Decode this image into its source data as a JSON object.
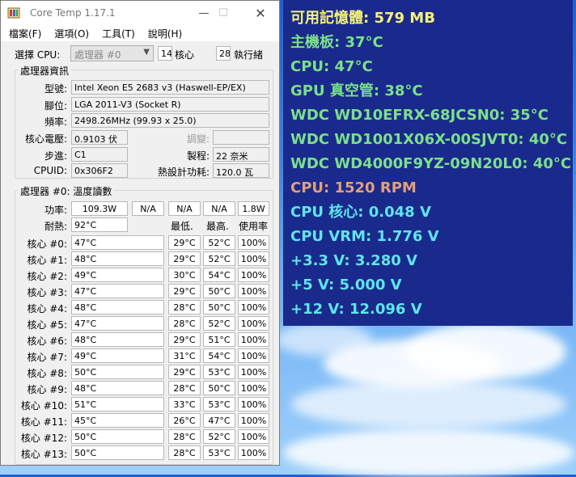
{
  "window": {
    "title": "Core Temp 1.17.1",
    "menus": [
      "檔案(F)",
      "選項(O)",
      "工具(T)",
      "說明(H)"
    ]
  },
  "select_cpu": {
    "label": "選擇 CPU:",
    "value": "處理器 #0",
    "cores_value": "14",
    "cores_label": "核心",
    "threads_value": "28",
    "threads_label": "執行緒"
  },
  "processor_info": {
    "title": "處理器資訊",
    "model_label": "型號:",
    "model_value": "Intel Xeon E5 2683 v3 (Haswell-EP/EX)",
    "platform_label": "腳位:",
    "platform_value": "LGA 2011-V3 (Socket R)",
    "freq_label": "頻率:",
    "freq_value": "2498.26MHz (99.93 x 25.0)",
    "vid_label": "核心電壓:",
    "vid_value": "0.9103 伏",
    "mod_label": "調變:",
    "mod_value": "",
    "stepping_label": "步進:",
    "stepping_value": "C1",
    "lith_label": "製程:",
    "lith_value": "22 奈米",
    "cpuid_label": "CPUID:",
    "cpuid_value": "0x306F2",
    "tdp_label": "熱設計功耗:",
    "tdp_value": "120.0 瓦"
  },
  "temps": {
    "title": "處理器 #0: 溫度讀數",
    "power_label": "功率:",
    "power_values": [
      "109.3W",
      "N/A",
      "N/A",
      "N/A",
      "1.8W"
    ],
    "tjmax_label": "耐熱:",
    "tjmax_value": "92°C",
    "col_min": "最低.",
    "col_max": "最高.",
    "col_load": "使用率",
    "cores": [
      {
        "label": "核心 #0:",
        "temp": "47°C",
        "min": "29°C",
        "max": "52°C",
        "load": "100%"
      },
      {
        "label": "核心 #1:",
        "temp": "48°C",
        "min": "29°C",
        "max": "52°C",
        "load": "100%"
      },
      {
        "label": "核心 #2:",
        "temp": "49°C",
        "min": "30°C",
        "max": "54°C",
        "load": "100%"
      },
      {
        "label": "核心 #3:",
        "temp": "47°C",
        "min": "29°C",
        "max": "50°C",
        "load": "100%"
      },
      {
        "label": "核心 #4:",
        "temp": "48°C",
        "min": "28°C",
        "max": "50°C",
        "load": "100%"
      },
      {
        "label": "核心 #5:",
        "temp": "47°C",
        "min": "28°C",
        "max": "52°C",
        "load": "100%"
      },
      {
        "label": "核心 #6:",
        "temp": "48°C",
        "min": "29°C",
        "max": "51°C",
        "load": "100%"
      },
      {
        "label": "核心 #7:",
        "temp": "49°C",
        "min": "31°C",
        "max": "54°C",
        "load": "100%"
      },
      {
        "label": "核心 #8:",
        "temp": "50°C",
        "min": "29°C",
        "max": "53°C",
        "load": "100%"
      },
      {
        "label": "核心 #9:",
        "temp": "48°C",
        "min": "28°C",
        "max": "50°C",
        "load": "100%"
      },
      {
        "label": "核心 #10:",
        "temp": "51°C",
        "min": "33°C",
        "max": "53°C",
        "load": "100%"
      },
      {
        "label": "核心 #11:",
        "temp": "45°C",
        "min": "26°C",
        "max": "47°C",
        "load": "100%"
      },
      {
        "label": "核心 #12:",
        "temp": "50°C",
        "min": "28°C",
        "max": "52°C",
        "load": "100%"
      },
      {
        "label": "核心 #13:",
        "temp": "50°C",
        "min": "28°C",
        "max": "53°C",
        "load": "100%"
      }
    ]
  },
  "overlay": {
    "lines": [
      {
        "text": "可用記憶體: 579 MB",
        "color": "#f6f27a"
      },
      {
        "text": "主機板: 37°C",
        "color": "#7be08a"
      },
      {
        "text": "CPU: 47°C",
        "color": "#7be08a"
      },
      {
        "text": "GPU 真空管: 38°C",
        "color": "#7be08a"
      },
      {
        "text": "WDC WD10EFRX-68JCSN0: 35°C",
        "color": "#7be08a"
      },
      {
        "text": "WDC WD1001X06X-00SJVT0: 40°C",
        "color": "#7be08a"
      },
      {
        "text": "WDC WD4000F9YZ-09N20L0: 40°C",
        "color": "#7be08a"
      },
      {
        "text": "CPU: 1520 RPM",
        "color": "#e2a07c"
      },
      {
        "text": "CPU 核心: 0.048 V",
        "color": "#5ee6ec"
      },
      {
        "text": "CPU VRM: 1.776 V",
        "color": "#5ee6ec"
      },
      {
        "text": "+3.3 V: 3.280 V",
        "color": "#5ee6ec"
      },
      {
        "text": "+5 V: 5.000 V",
        "color": "#5ee6ec"
      },
      {
        "text": "+12 V: 12.096 V",
        "color": "#5ee6ec"
      }
    ]
  }
}
